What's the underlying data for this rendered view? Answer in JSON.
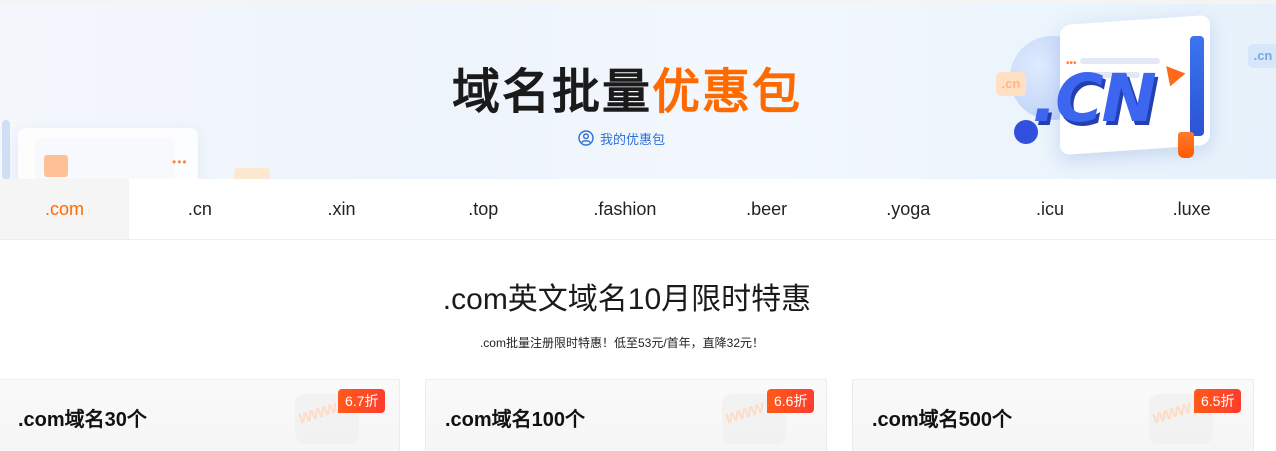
{
  "hero": {
    "title_dark": "域名批量",
    "title_orange": "优惠包",
    "my_coupon_link": "我的优惠包",
    "deco_cn_big": ".CN",
    "deco_cn_small": ".cn"
  },
  "tabs": [
    ".com",
    ".cn",
    ".xin",
    ".top",
    ".fashion",
    ".beer",
    ".yoga",
    ".icu",
    ".luxe"
  ],
  "active_tab": ".com",
  "section": {
    "title": ".com英文域名10月限时特惠",
    "subtitle": ".com批量注册限时特惠！低至53元/首年，直降32元！"
  },
  "cards": [
    {
      "title": ".com域名30个",
      "badge": "6.7折",
      "watermark": "www"
    },
    {
      "title": ".com域名100个",
      "badge": "6.6折",
      "watermark": "www"
    },
    {
      "title": ".com域名500个",
      "badge": "6.5折",
      "watermark": "www"
    }
  ],
  "colors": {
    "accent_orange": "#ff6a00",
    "link_blue": "#2e6fd9",
    "badge_red": "#ff3d2e"
  },
  "icons": {
    "my_coupon": "user-circle-icon"
  }
}
